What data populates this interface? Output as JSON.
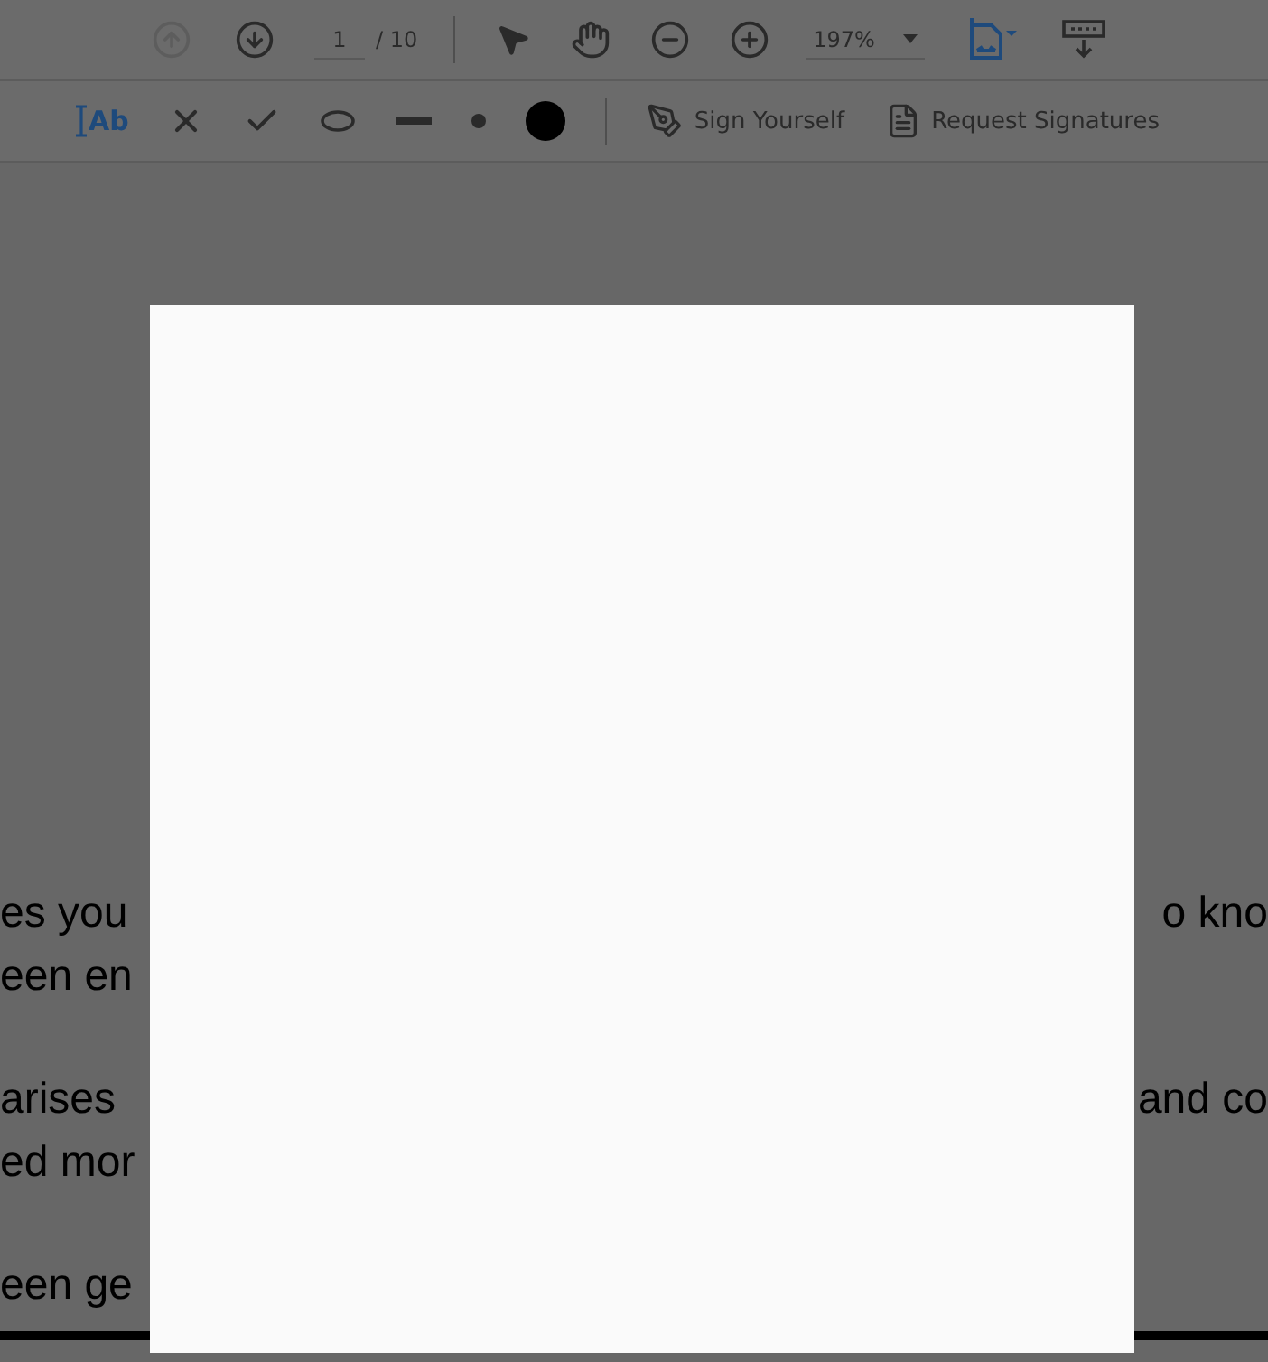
{
  "toolbar": {
    "prev_page": {
      "disabled": true
    },
    "next_page": {
      "disabled": false
    },
    "page_number": "1",
    "page_total": "/ 10",
    "zoom": "197%"
  },
  "comment_tools": {
    "text_tool": "Ab",
    "tools": [
      {
        "kind": "cross"
      },
      {
        "kind": "check"
      },
      {
        "kind": "ellipse"
      },
      {
        "kind": "line"
      },
      {
        "kind": "small-dot"
      },
      {
        "kind": "large-dot"
      }
    ],
    "actions": [
      {
        "kind": "sign",
        "label": "Sign Yourself"
      },
      {
        "kind": "request",
        "label": "Request Signatures"
      }
    ]
  },
  "document": {
    "lines": [
      {
        "left": "es you",
        "right": "o kno"
      },
      {
        "left": "een en"
      },
      {
        "left": "arises",
        "right": "and co"
      },
      {
        "left": "ed mor"
      },
      {
        "left": "een ge"
      }
    ]
  },
  "dialog": {
    "kind": "blank"
  }
}
